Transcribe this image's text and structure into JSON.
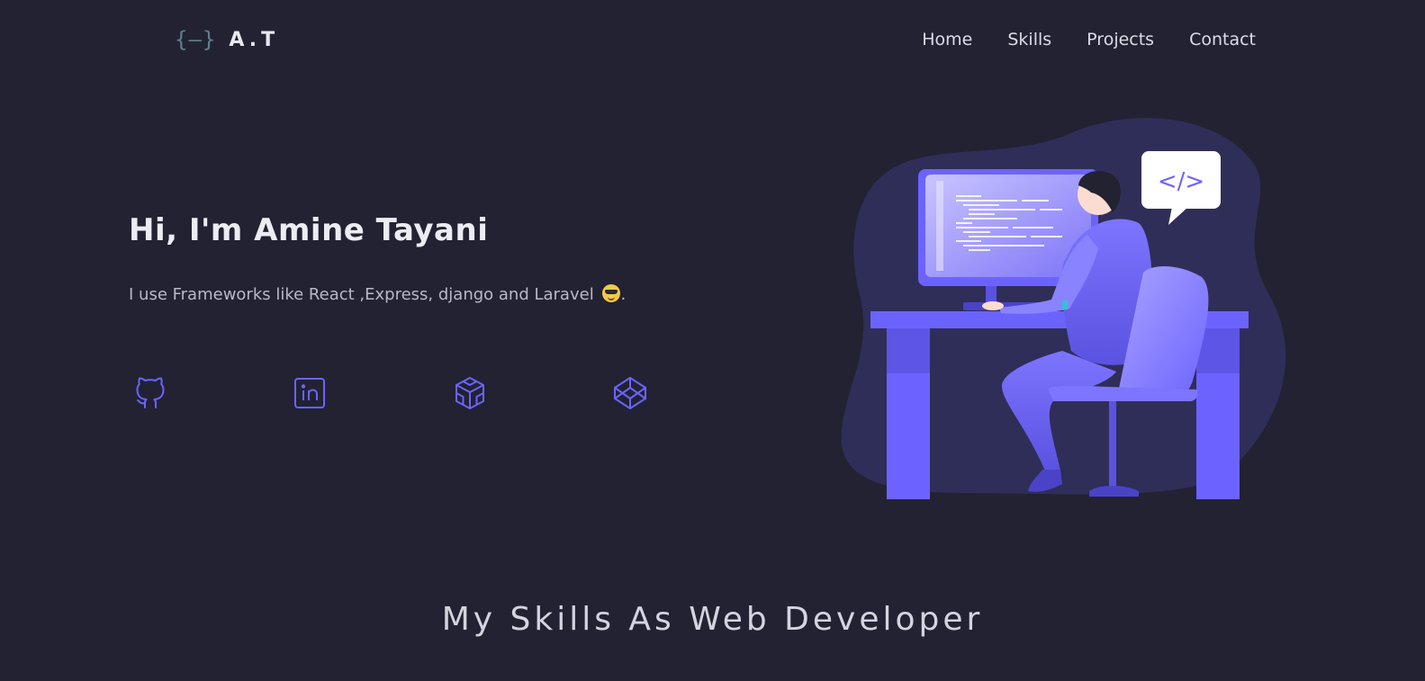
{
  "header": {
    "logo_mark": "{–}",
    "logo_text": "A.T",
    "nav": [
      {
        "label": "Home"
      },
      {
        "label": "Skills"
      },
      {
        "label": "Projects"
      },
      {
        "label": "Contact"
      }
    ]
  },
  "hero": {
    "title": "Hi, I'm Amine Tayani",
    "subtitle": "I use Frameworks like React ,Express, django and Laravel",
    "subtitle_end": ".",
    "social_icons": [
      "github-icon",
      "linkedin-icon",
      "codesandbox-icon",
      "codepen-icon"
    ],
    "speech_bubble": "</>"
  },
  "skills_section": {
    "title": "My Skills As Web Developer"
  },
  "colors": {
    "background": "#222233",
    "accent": "#6c63ff",
    "blob": "#2f2e58"
  }
}
